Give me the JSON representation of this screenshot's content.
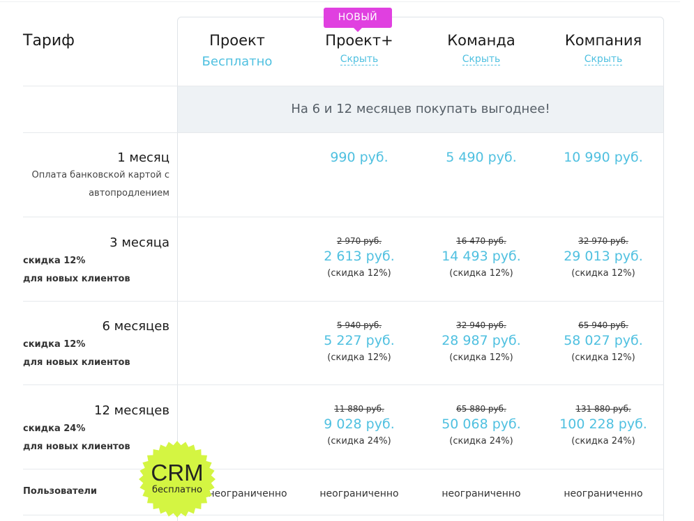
{
  "header": {
    "label": "Тариф",
    "badge": "НОВЫЙ",
    "plans": [
      {
        "name": "Проект",
        "sub": "Бесплатно"
      },
      {
        "name": "Проект+",
        "sub": "Скрыть"
      },
      {
        "name": "Команда",
        "sub": "Скрыть"
      },
      {
        "name": "Компания",
        "sub": "Скрыть"
      }
    ]
  },
  "promo": "На 6 и 12 месяцев покупать выгоднее!",
  "rows": [
    {
      "period": "1 месяц",
      "note": "Оплата банковской картой с автопродлением",
      "prices": [
        {
          "price": "990 руб."
        },
        {
          "price": "5 490 руб."
        },
        {
          "price": "10 990 руб."
        }
      ]
    },
    {
      "period": "3 месяца",
      "discount_line1": "скидка 12%",
      "discount_line2": "для новых клиентов",
      "prices": [
        {
          "old": "2 970 руб.",
          "price": "2 613 руб.",
          "disc": "(скидка 12%)"
        },
        {
          "old": "16 470 руб.",
          "price": "14 493 руб.",
          "disc": "(скидка 12%)"
        },
        {
          "old": "32 970 руб.",
          "price": "29 013 руб.",
          "disc": "(скидка 12%)"
        }
      ]
    },
    {
      "period": "6 месяцев",
      "discount_line1": "скидка 12%",
      "discount_line2": "для новых клиентов",
      "prices": [
        {
          "old": "5 940 руб.",
          "price": "5 227 руб.",
          "disc": "(скидка 12%)"
        },
        {
          "old": "32 940 руб.",
          "price": "28 987 руб.",
          "disc": "(скидка 12%)"
        },
        {
          "old": "65 940 руб.",
          "price": "58 027 руб.",
          "disc": "(скидка 12%)"
        }
      ]
    },
    {
      "period": "12 месяцев",
      "discount_line1": "скидка 24%",
      "discount_line2": "для новых клиентов",
      "prices": [
        {
          "old": "11 880 руб.",
          "price": "9 028 руб.",
          "disc": "(скидка 24%)"
        },
        {
          "old": "65 880 руб.",
          "price": "50 068 руб.",
          "disc": "(скидка 24%)"
        },
        {
          "old": "131 880 руб.",
          "price": "100 228 руб.",
          "disc": "(скидка 24%)"
        }
      ]
    }
  ],
  "users": {
    "label": "Пользователи",
    "values": [
      "неограниченно",
      "неограниченно",
      "неограниченно",
      "неограниченно"
    ]
  },
  "crm_badge": {
    "title": "CRM",
    "subtitle": "бесплатно"
  },
  "colors": {
    "accent": "#4fc0e0",
    "badge": "#e040e0",
    "seal": "#d4f542",
    "promo_bg": "#eef2f5"
  }
}
